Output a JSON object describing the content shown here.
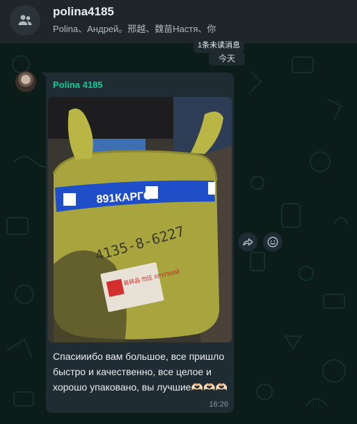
{
  "header": {
    "title": "polina4185",
    "subtitle": "Polina、Андрей。邢越、魏苗Настя、你"
  },
  "chat": {
    "unread_banner": "1条未读消息",
    "date_divider": "今天"
  },
  "message": {
    "sender": "Polina 4185",
    "photo_label_band": "891КАРГО",
    "photo_handwriting": "4135-8-6227",
    "photo_sticker": "易碎品 勿压 ХРУПКИЙ",
    "text": "Спасииибо вам большое, все пришло быстро и качественно, все целое и хорошо упаковано, вы лучшие🫶🏻🫶🏻🫶🏻",
    "time": "16:26"
  },
  "colors": {
    "header_bg": "#1f2528",
    "chat_bg": "#0b1c19",
    "bubble_bg": "#202c33",
    "sender_name": "#06cf9c"
  },
  "icons": {
    "header_avatar": "group-icon",
    "forward": "forward-icon",
    "react": "emoji-icon"
  }
}
